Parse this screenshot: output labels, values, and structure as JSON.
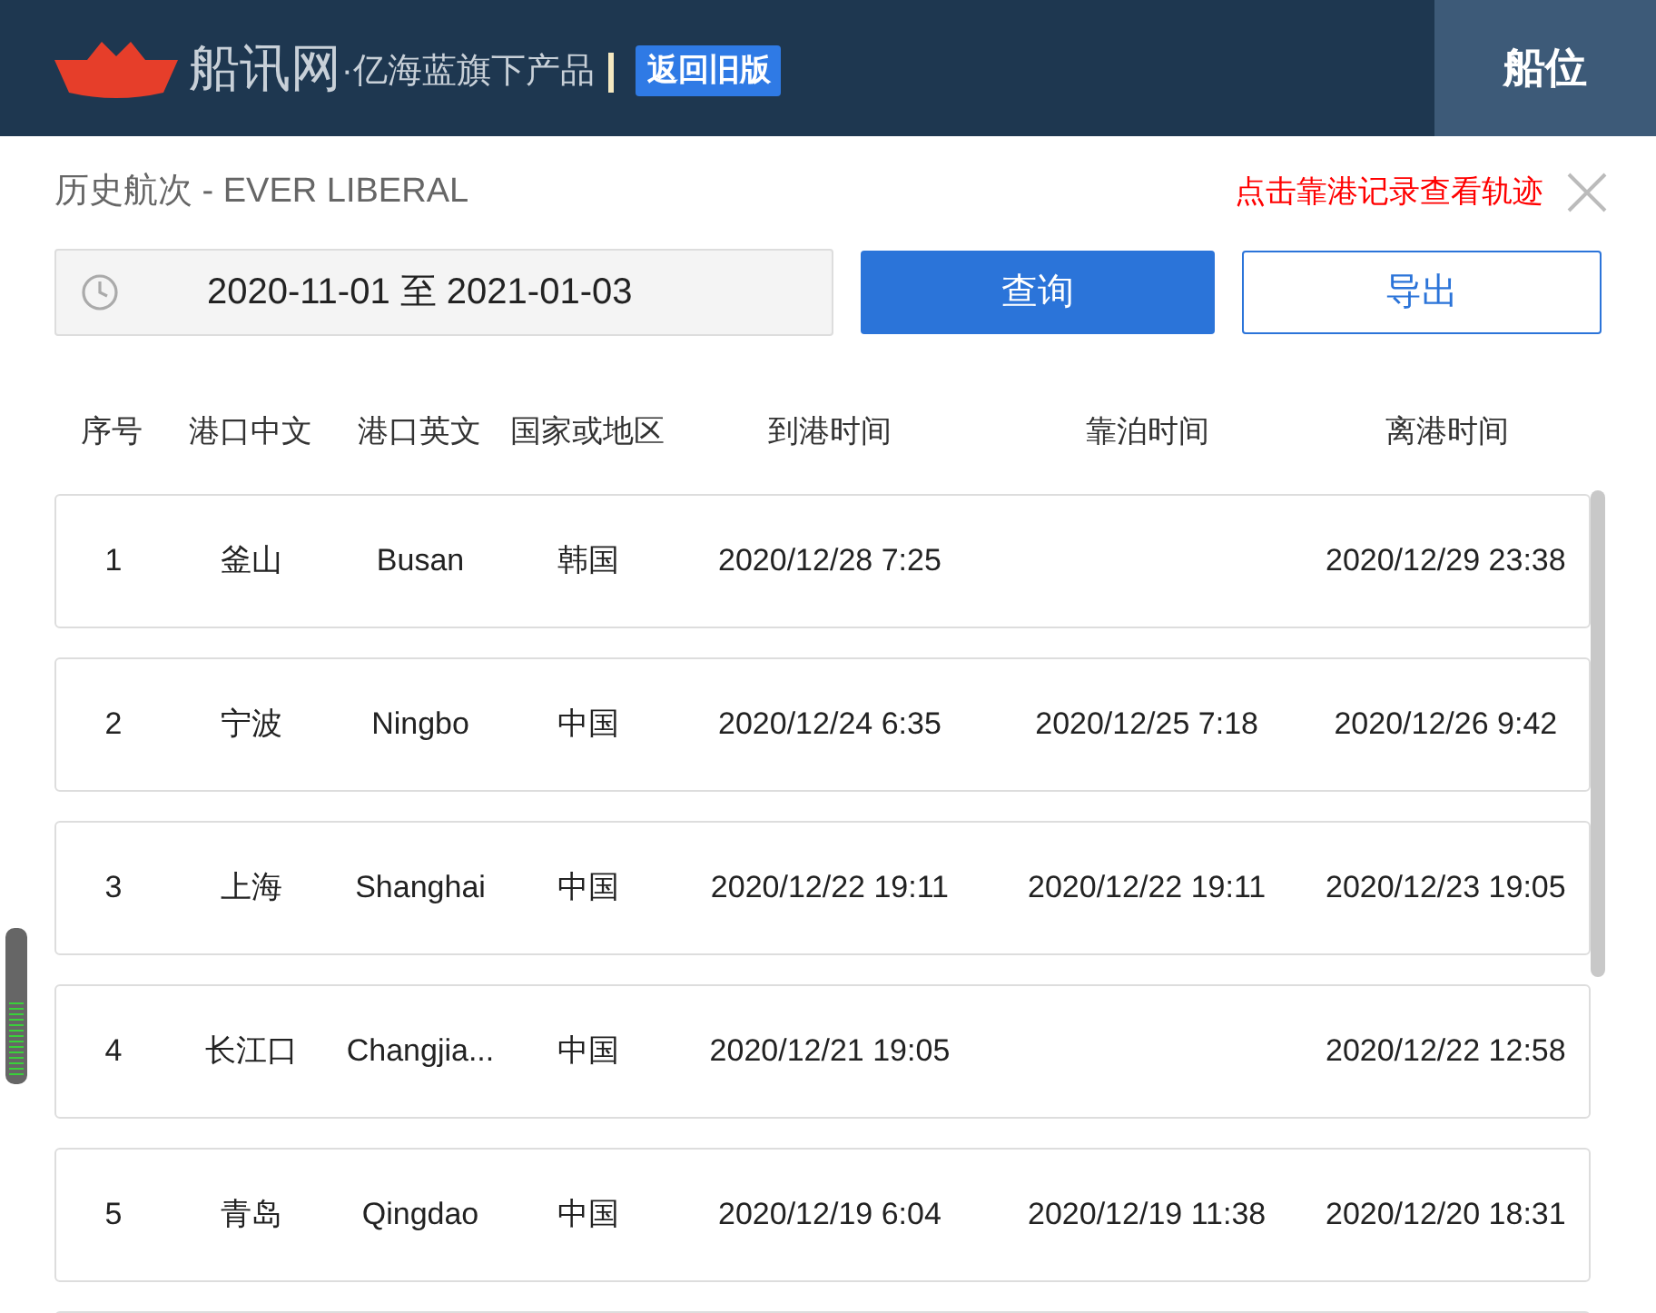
{
  "header": {
    "logo_text": "船讯网",
    "tagline": "·亿海蓝旗下产品",
    "old_version_button": "返回旧版",
    "nav_tab": {
      "label": "船位",
      "selected": true
    }
  },
  "panel": {
    "title": "历史航次 - EVER LIBERAL",
    "hint": "点击靠港记录查看轨迹",
    "date_range": "2020-11-01 至 2021-01-03",
    "query_button": "查询",
    "export_button": "导出"
  },
  "table": {
    "columns": [
      "序号",
      "港口中文",
      "港口英文",
      "国家或地区",
      "到港时间",
      "靠泊时间",
      "离港时间"
    ],
    "rows": [
      {
        "no": "1",
        "port_cn": "釜山",
        "port_en": "Busan",
        "country": "韩国",
        "arrival": "2020/12/28 7:25",
        "departure": "2020/12/29 23:38"
      },
      {
        "no": "2",
        "port_cn": "宁波",
        "port_en": "Ningbo",
        "country": "中国",
        "arrival": "2020/12/24 6:35",
        "berthing": "2020/12/25 7:18",
        "departure": "2020/12/26 9:42"
      },
      {
        "no": "3",
        "port_cn": "上海",
        "port_en": "Shanghai",
        "country": "中国",
        "arrival": "2020/12/22 19:11",
        "berthing": "2020/12/22 19:11",
        "departure": "2020/12/23 19:05"
      },
      {
        "no": "4",
        "port_cn": "长江口",
        "port_en": "Changjia...",
        "country": "中国",
        "arrival": "2020/12/21 19:05",
        "departure": "2020/12/22 12:58"
      },
      {
        "no": "5",
        "port_cn": "青岛",
        "port_en": "Qingdao",
        "country": "中国",
        "arrival": "2020/12/19 6:04",
        "berthing": "2020/12/19 11:38",
        "departure": "2020/12/20 18:31"
      }
    ]
  }
}
